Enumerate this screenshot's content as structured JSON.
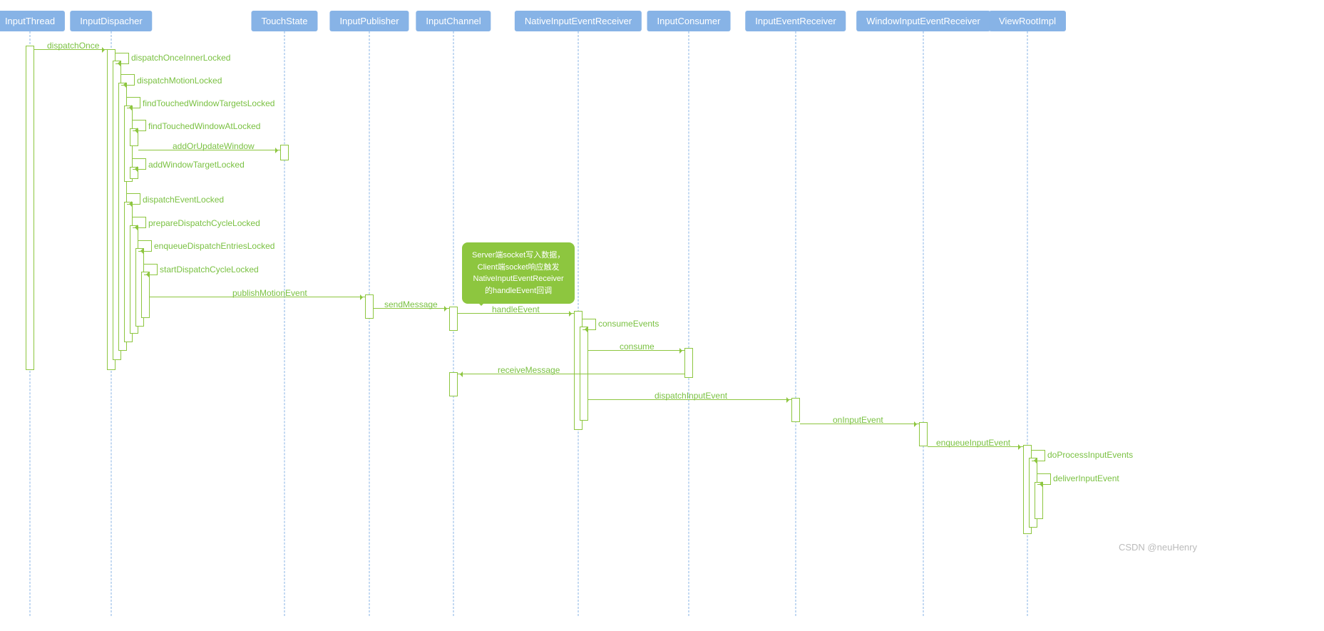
{
  "chart_data": {
    "type": "sequence-diagram",
    "participants": [
      "InputThread",
      "InputDispacher",
      "TouchState",
      "InputPublisher",
      "InputChannel",
      "NativeInputEventReceiver",
      "InputConsumer",
      "InputEventReceiver",
      "WindowInputEventReceiver",
      "ViewRootImpl"
    ],
    "messages": [
      {
        "from": "InputThread",
        "to": "InputDispacher",
        "label": "dispatchOnce"
      },
      {
        "from": "InputDispacher",
        "to": "InputDispacher",
        "label": "dispatchOnceInnerLocked"
      },
      {
        "from": "InputDispacher",
        "to": "InputDispacher",
        "label": "dispatchMotionLocked"
      },
      {
        "from": "InputDispacher",
        "to": "InputDispacher",
        "label": "findTouchedWindowTargetsLocked"
      },
      {
        "from": "InputDispacher",
        "to": "InputDispacher",
        "label": "findTouchedWindowAtLocked"
      },
      {
        "from": "InputDispacher",
        "to": "TouchState",
        "label": "addOrUpdateWindow"
      },
      {
        "from": "InputDispacher",
        "to": "InputDispacher",
        "label": "addWindowTargetLocked"
      },
      {
        "from": "InputDispacher",
        "to": "InputDispacher",
        "label": "dispatchEventLocked"
      },
      {
        "from": "InputDispacher",
        "to": "InputDispacher",
        "label": "prepareDispatchCycleLocked"
      },
      {
        "from": "InputDispacher",
        "to": "InputDispacher",
        "label": "enqueueDispatchEntriesLocked"
      },
      {
        "from": "InputDispacher",
        "to": "InputDispacher",
        "label": "startDispatchCycleLocked"
      },
      {
        "from": "InputDispacher",
        "to": "InputPublisher",
        "label": "publishMotionEvent"
      },
      {
        "from": "InputPublisher",
        "to": "InputChannel",
        "label": "sendMessage"
      },
      {
        "from": "InputChannel",
        "to": "NativeInputEventReceiver",
        "label": "handleEvent",
        "note": "Server端socket写入数据，Client端socket响应触发NativeInputEventReceiver的handleEvent回调"
      },
      {
        "from": "NativeInputEventReceiver",
        "to": "NativeInputEventReceiver",
        "label": "consumeEvents"
      },
      {
        "from": "NativeInputEventReceiver",
        "to": "InputConsumer",
        "label": "consume"
      },
      {
        "from": "InputConsumer",
        "to": "InputChannel",
        "label": "receiveMessage"
      },
      {
        "from": "NativeInputEventReceiver",
        "to": "InputEventReceiver",
        "label": "dispatchInputEvent"
      },
      {
        "from": "InputEventReceiver",
        "to": "WindowInputEventReceiver",
        "label": "onInputEvent"
      },
      {
        "from": "WindowInputEventReceiver",
        "to": "ViewRootImpl",
        "label": "enqueueInputEvent"
      },
      {
        "from": "ViewRootImpl",
        "to": "ViewRootImpl",
        "label": "doProcessInputEvents"
      },
      {
        "from": "ViewRootImpl",
        "to": "ViewRootImpl",
        "label": "deliverInputEvent"
      }
    ]
  },
  "p": {
    "p0": "InputThread",
    "p1": "InputDispacher",
    "p2": "TouchState",
    "p3": "InputPublisher",
    "p4": "InputChannel",
    "p5": "NativeInputEventReceiver",
    "p6": "InputConsumer",
    "p7": "InputEventReceiver",
    "p8": "WindowInputEventReceiver",
    "p9": "ViewRootImpl"
  },
  "m": {
    "m0": "dispatchOnce",
    "m1": "dispatchOnceInnerLocked",
    "m2": "dispatchMotionLocked",
    "m3": "findTouchedWindowTargetsLocked",
    "m4": "findTouchedWindowAtLocked",
    "m5": "addOrUpdateWindow",
    "m6": "addWindowTargetLocked",
    "m7": "dispatchEventLocked",
    "m8": "prepareDispatchCycleLocked",
    "m9": "enqueueDispatchEntriesLocked",
    "m10": "startDispatchCycleLocked",
    "m11": "publishMotionEvent",
    "m12": "sendMessage",
    "m13": "handleEvent",
    "m14": "consumeEvents",
    "m15": "consume",
    "m16": "receiveMessage",
    "m17": "dispatchInputEvent",
    "m18": "onInputEvent",
    "m19": "enqueueInputEvent",
    "m20": "doProcessInputEvents",
    "m21": "deliverInputEvent"
  },
  "note": {
    "l1": "Server端socket写入数据，",
    "l2": "Client端socket响应触发",
    "l3": "NativeInputEventReceiver",
    "l4": "的handleEvent回调"
  },
  "wm": "CSDN @neuHenry"
}
